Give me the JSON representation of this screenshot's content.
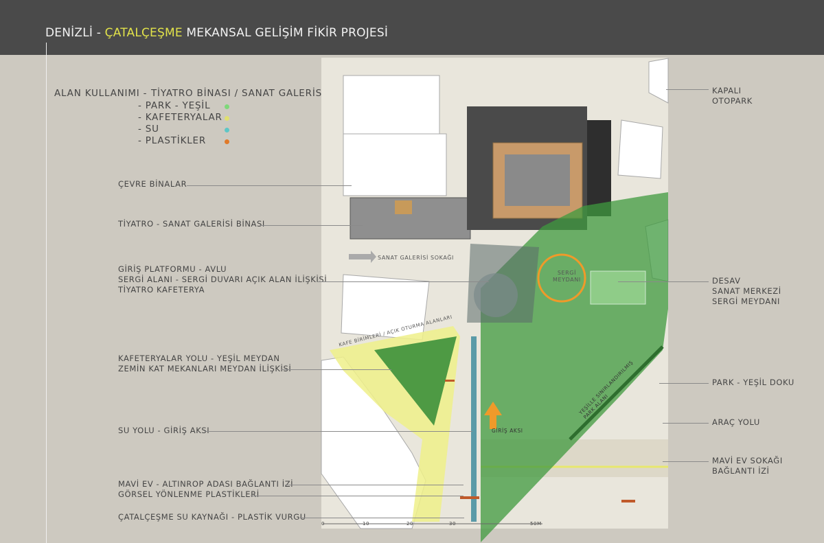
{
  "header": {
    "title_part1": "DENİZLİ - ",
    "title_highlight": "ÇATALÇEŞME",
    "title_part2": " MEKANSAL GELİŞİM FİKİR PROJESİ",
    "highlight_color": "#e2e34a"
  },
  "legend": {
    "heading": "ALAN KULLANIMI -",
    "items": [
      {
        "label": "TİYATRO BİNASI / SANAT GALERİSİ",
        "color": ""
      },
      {
        "label": "-   PARK - YEŞİL",
        "color": "#7fd87a"
      },
      {
        "label": "-   KAFETERYALAR",
        "color": "#e0e070"
      },
      {
        "label": "-   SU",
        "color": "#5ec6c6"
      },
      {
        "label": "-   PLASTİKLER",
        "color": "#e07a2a"
      }
    ]
  },
  "left_labels": [
    {
      "text": "ÇEVRE BİNALAR"
    },
    {
      "text": "TİYATRO - SANAT GALERİSİ BİNASI"
    },
    {
      "text": "GİRİŞ PLATFORMU - AVLU\nSERGİ ALANI - SERGİ DUVARI AÇIK ALAN İLİŞKİSİ\nTİYATRO KAFETERYA"
    },
    {
      "text": "KAFETERYALAR YOLU - YEŞİL MEYDAN\nZEMİN KAT MEKANLARI MEYDAN İLİŞKİSİ"
    },
    {
      "text": "SU YOLU - GİRİŞ AKSI"
    },
    {
      "text": "MAVİ EV - ALTINROP ADASI BAĞLANTI İZİ\nGÖRSEL YÖNLENME PLASTİKLERİ"
    },
    {
      "text": "ÇATALÇEŞME SU KAYNAĞI - PLASTİK VURGU"
    }
  ],
  "right_labels": [
    {
      "text": "KAPALI\nOTOPARK"
    },
    {
      "text": "DESAV\nSANAT MERKEZİ\nSERGİ MEYDANI"
    },
    {
      "text": "PARK - YEŞİL DOKU"
    },
    {
      "text": "ARAÇ YOLU"
    },
    {
      "text": "MAVİ EV SOKAĞI\nBAĞLANTI İZİ"
    }
  ],
  "plan_labels": {
    "gallery_street": "SANAT GALERİSİ SOKAĞI",
    "exhibition_square": "SERGİ\nMEYDANI",
    "cafe_units": "KAFE BİRİMLERİ / AÇIK OTURMA ALANLARI",
    "green_park": "YEŞİLLE SINIRLANDIRILMIŞ\nPARK ALANI",
    "entrance_axis": "GİRİŞ AKSI"
  },
  "scale_bar": {
    "ticks": [
      "0",
      "10",
      "20",
      "30",
      "50M"
    ]
  },
  "colors": {
    "green": "#3a9a3a",
    "yellow": "#eeee88",
    "orange": "#ef9a2a",
    "water": "#5aa0a8",
    "building": "#ffffff"
  }
}
